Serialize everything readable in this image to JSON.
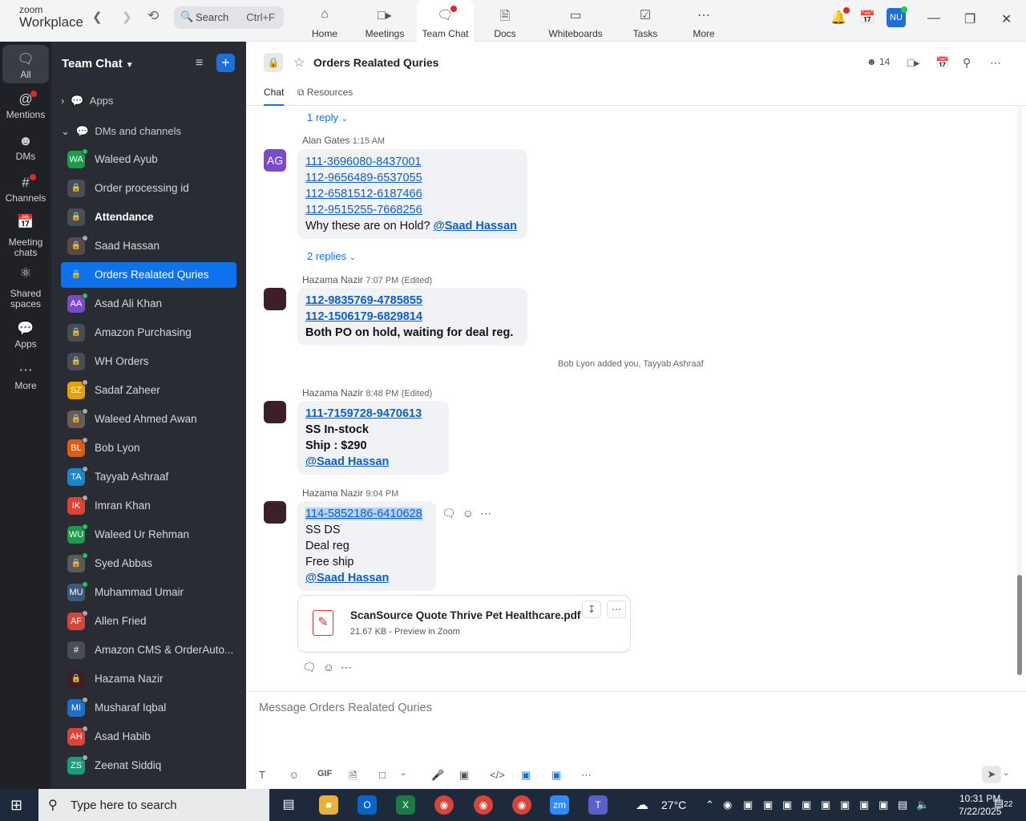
{
  "app": {
    "logo_top": "zoom",
    "logo_bottom": "Workplace"
  },
  "topbar": {
    "search_label": "Search",
    "search_shortcut": "Ctrl+F",
    "tabs": [
      {
        "label": "Home",
        "icon": "home-icon"
      },
      {
        "label": "Meetings",
        "icon": "video-camera-icon"
      },
      {
        "label": "Team Chat",
        "icon": "chat-bubbles-icon"
      },
      {
        "label": "Docs",
        "icon": "doc-icon"
      },
      {
        "label": "Whiteboards",
        "icon": "whiteboard-icon"
      },
      {
        "label": "Tasks",
        "icon": "tasks-icon"
      },
      {
        "label": "More",
        "icon": "more-icon"
      }
    ],
    "active_tab": "Team Chat",
    "avatar_initials": "NU"
  },
  "rail": {
    "items": [
      {
        "label": "All",
        "icon": "chat-bubble-icon"
      },
      {
        "label": "Mentions",
        "icon": "at-icon"
      },
      {
        "label": "DMs",
        "icon": "people-icon"
      },
      {
        "label": "Channels",
        "icon": "hash-icon"
      },
      {
        "label": "Meeting chats",
        "icon": "calendar-icon"
      },
      {
        "label": "Shared spaces",
        "icon": "share-icon"
      },
      {
        "label": "Apps",
        "icon": "apps-icon"
      },
      {
        "label": "More",
        "icon": "ellipsis-icon"
      }
    ]
  },
  "sidebar": {
    "title": "Team Chat",
    "sections": {
      "apps": "Apps",
      "dms": "DMs and channels"
    },
    "items": [
      {
        "name": "Waleed Ayub",
        "initials": "WA",
        "color": "#1d9b4a",
        "status": "#22c55e"
      },
      {
        "name": "Order processing id",
        "initials": "",
        "color": "#4a4d55",
        "status": ""
      },
      {
        "name": "Attendance",
        "initials": "",
        "color": "#4a4d55",
        "status": ""
      },
      {
        "name": "Saad Hassan",
        "initials": "",
        "color": "#5a4a45",
        "status": "#aaaaaa"
      },
      {
        "name": "Orders Realated Quries",
        "initials": "",
        "color": "#0e72ed",
        "status": ""
      },
      {
        "name": "Asad Ali Khan",
        "initials": "AA",
        "color": "#7a4bc9",
        "status": "#22c55e"
      },
      {
        "name": "Amazon Purchasing",
        "initials": "",
        "color": "#4a4d55",
        "status": ""
      },
      {
        "name": "WH Orders",
        "initials": "",
        "color": "#4a4d55",
        "status": ""
      },
      {
        "name": "Sadaf Zaheer",
        "initials": "SZ",
        "color": "#e6a000",
        "status": "#aaaaaa"
      },
      {
        "name": "Waleed Ahmed Awan",
        "initials": "",
        "color": "#6b5a55",
        "status": "#aaaaaa"
      },
      {
        "name": "Bob Lyon",
        "initials": "BL",
        "color": "#d95b16",
        "status": "#aaaaaa"
      },
      {
        "name": "Tayyab Ashraaf",
        "initials": "TA",
        "color": "#1b86c9",
        "status": "#aaaaaa"
      },
      {
        "name": "Imran Khan",
        "initials": "IK",
        "color": "#d9433a",
        "status": "#aaaaaa"
      },
      {
        "name": "Waleed Ur Rehman",
        "initials": "WU",
        "color": "#1d9b4a",
        "status": "#22c55e"
      },
      {
        "name": "Syed Abbas",
        "initials": "",
        "color": "#5a5a5a",
        "status": "#22c55e"
      },
      {
        "name": "Muhammad Umair",
        "initials": "MU",
        "color": "#3a5a7a",
        "status": "#22c55e"
      },
      {
        "name": "Allen Fried",
        "initials": "AF",
        "color": "#d9433a",
        "status": "#aaaaaa"
      },
      {
        "name": "Amazon CMS & OrderAuto...",
        "initials": "#",
        "color": "#4a4d55",
        "status": ""
      },
      {
        "name": "Hazama Nazir",
        "initials": "",
        "color": "#3d1f2a",
        "status": ""
      },
      {
        "name": "Musharaf Iqbal",
        "initials": "MI",
        "color": "#1b6ec9",
        "status": "#aaaaaa"
      },
      {
        "name": "Asad Habib",
        "initials": "AH",
        "color": "#d9433a",
        "status": "#aaaaaa"
      },
      {
        "name": "Zeenat Siddiq",
        "initials": "ZS",
        "color": "#1d9b7a",
        "status": "#aaaaaa"
      }
    ]
  },
  "channel": {
    "title": "Orders Realated Quries",
    "member_count": "14",
    "tabs": [
      "Chat",
      "Resources"
    ]
  },
  "messages": {
    "reply1": "1 reply",
    "m1": {
      "sender": "Alan Gates",
      "time": "1:15 AM",
      "initials": "AG",
      "lines": [
        "111-3696080-8437001",
        "112-9656489-6537055",
        "112-6581512-6187466",
        "112-9515255-7668256"
      ],
      "question": "Why these are on Hold?",
      "mention": "@Saad Hassan"
    },
    "reply2": "2 replies",
    "m2": {
      "sender": "Hazama Nazir",
      "time": "7:07 PM",
      "edited": "(Edited)",
      "lines": [
        "112-9835769-4785855",
        "112-1506179-6829814"
      ],
      "text": "Both PO on hold, waiting for deal reg."
    },
    "system": "Bob Lyon added you, Tayyab Ashraaf",
    "m3": {
      "sender": "Hazama Nazir",
      "time": "8:48 PM",
      "edited": "(Edited)",
      "link": "111-7159728-9470613",
      "l2": "SS In-stock",
      "l3": "Ship : $290",
      "mention": "@Saad Hassan"
    },
    "m4": {
      "sender": "Hazama Nazir",
      "time": "9:04 PM",
      "link": "114-5852186-6410628",
      "l2": "SS DS",
      "l3": "Deal reg",
      "l4": "Free ship",
      "mention": "@Saad Hassan"
    },
    "file": {
      "name": "ScanSource Quote Thrive Pet Healthcare.pdf",
      "meta": "21.67 KB - Preview in Zoom"
    }
  },
  "composer": {
    "placeholder": "Message Orders Realated Quries",
    "gif": "GIF"
  },
  "taskbar": {
    "search": "Type here to search",
    "weather": "27°C",
    "time": "10:31 PM",
    "date": "7/22/2025",
    "notif": "22"
  }
}
